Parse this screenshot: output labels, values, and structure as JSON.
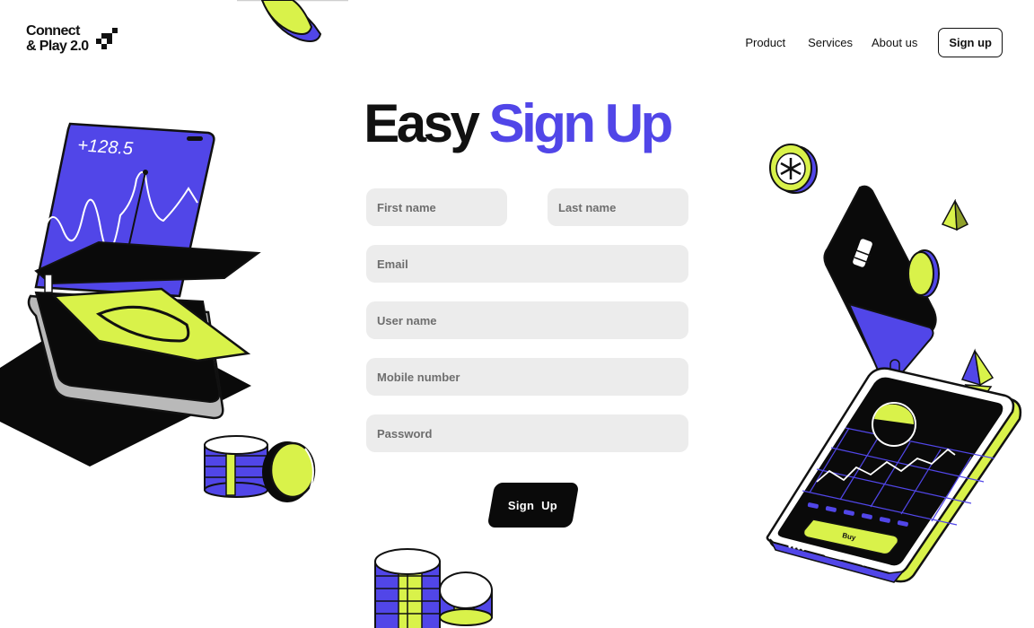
{
  "brand": {
    "line1": "Connect",
    "line2": "& Play 2.0"
  },
  "nav": {
    "links": [
      "Product",
      "Services",
      "About us"
    ],
    "signup_label": "Sign up"
  },
  "hero": {
    "title_plain": "Easy",
    "title_accent": "Sign Up"
  },
  "form": {
    "first_name_placeholder": "First name",
    "last_name_placeholder": "Last name",
    "email_placeholder": "Email",
    "username_placeholder": "User name",
    "mobile_placeholder": "Mobile number",
    "password_placeholder": "Password",
    "submit_label": "Sign  Up"
  },
  "illustrations": {
    "left_card_value": "+128.5",
    "phone_button_label": "Buy"
  },
  "colors": {
    "accent_purple": "#5146e8",
    "lime": "#d9f24a",
    "ink": "#0a0a0a",
    "field_bg": "#ececec"
  }
}
